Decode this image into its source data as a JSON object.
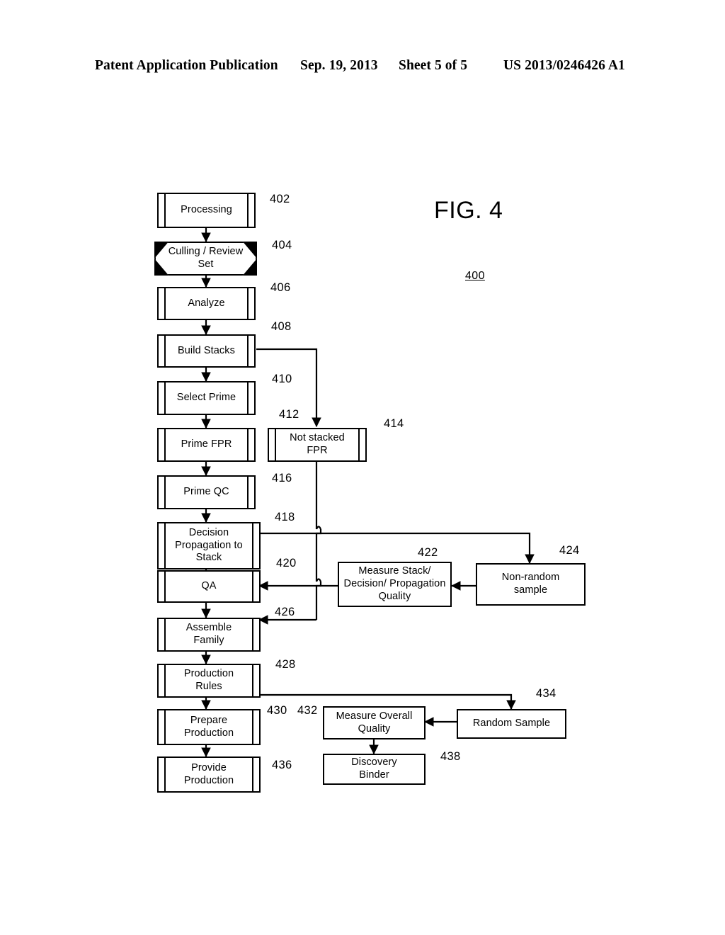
{
  "header": {
    "publication": "Patent Application Publication",
    "date": "Sep. 19, 2013",
    "sheet": "Sheet 5 of 5",
    "patent_number": "US 2013/0246426 A1"
  },
  "figure": {
    "title": "FIG. 4",
    "ref": "400"
  },
  "nodes": [
    {
      "id": "n402",
      "label": "Processing",
      "ref": "402",
      "shape": "predefined-process"
    },
    {
      "id": "n404",
      "label": "Culling / Review Set",
      "ref": "404",
      "shape": "hexagon"
    },
    {
      "id": "n406",
      "label": "Analyze",
      "ref": "406",
      "shape": "predefined-process"
    },
    {
      "id": "n408",
      "label": "Build Stacks",
      "ref": "408",
      "shape": "predefined-process"
    },
    {
      "id": "n410",
      "label": "Select Prime",
      "ref": "410",
      "shape": "predefined-process"
    },
    {
      "id": "n412",
      "label": "Prime FPR",
      "ref": "412",
      "shape": "predefined-process"
    },
    {
      "id": "n414",
      "label": "Not stacked FPR",
      "ref": "414",
      "shape": "predefined-process"
    },
    {
      "id": "n416",
      "label": "Prime QC",
      "ref": "416",
      "shape": "predefined-process"
    },
    {
      "id": "n418",
      "label": "Decision Propagation to Stack",
      "ref": "418",
      "shape": "predefined-process"
    },
    {
      "id": "n420",
      "label": "QA",
      "ref": "420",
      "shape": "predefined-process"
    },
    {
      "id": "n422",
      "label": "Measure Stack/ Decision/ Propagation Quality",
      "ref": "422",
      "shape": "rectangle"
    },
    {
      "id": "n424",
      "label": "Non-random sample",
      "ref": "424",
      "shape": "rectangle"
    },
    {
      "id": "n426",
      "label": "Assemble Family",
      "ref": "426",
      "shape": "predefined-process"
    },
    {
      "id": "n428",
      "label": "Production Rules",
      "ref": "428",
      "shape": "predefined-process"
    },
    {
      "id": "n430",
      "label": "Prepare Production",
      "ref": "430",
      "shape": "predefined-process"
    },
    {
      "id": "n432",
      "label": "Measure Overall Quality",
      "ref": "432",
      "shape": "rectangle"
    },
    {
      "id": "n434",
      "label": "Random Sample",
      "ref": "434",
      "shape": "rectangle"
    },
    {
      "id": "n436",
      "label": "Provide Production",
      "ref": "436",
      "shape": "predefined-process"
    },
    {
      "id": "n438",
      "label": "Discovery Binder",
      "ref": "438",
      "shape": "rectangle"
    }
  ],
  "flow_edges": [
    {
      "from": "n402",
      "to": "n404"
    },
    {
      "from": "n404",
      "to": "n406"
    },
    {
      "from": "n406",
      "to": "n408"
    },
    {
      "from": "n408",
      "to": "n410"
    },
    {
      "from": "n408",
      "to": "n414"
    },
    {
      "from": "n410",
      "to": "n412"
    },
    {
      "from": "n412",
      "to": "n416"
    },
    {
      "from": "n416",
      "to": "n418"
    },
    {
      "from": "n418",
      "to": "n420"
    },
    {
      "from": "n418",
      "to": "n424"
    },
    {
      "from": "n414",
      "to": "n420"
    },
    {
      "from": "n414",
      "to": "n426"
    },
    {
      "from": "n424",
      "to": "n422"
    },
    {
      "from": "n422",
      "to": "n420"
    },
    {
      "from": "n420",
      "to": "n426"
    },
    {
      "from": "n426",
      "to": "n428"
    },
    {
      "from": "n428",
      "to": "n430"
    },
    {
      "from": "n428",
      "to": "n434"
    },
    {
      "from": "n434",
      "to": "n432"
    },
    {
      "from": "n432",
      "to": "n438"
    },
    {
      "from": "n430",
      "to": "n436"
    }
  ],
  "colors": {
    "ink": "#000000",
    "paper": "#ffffff"
  }
}
